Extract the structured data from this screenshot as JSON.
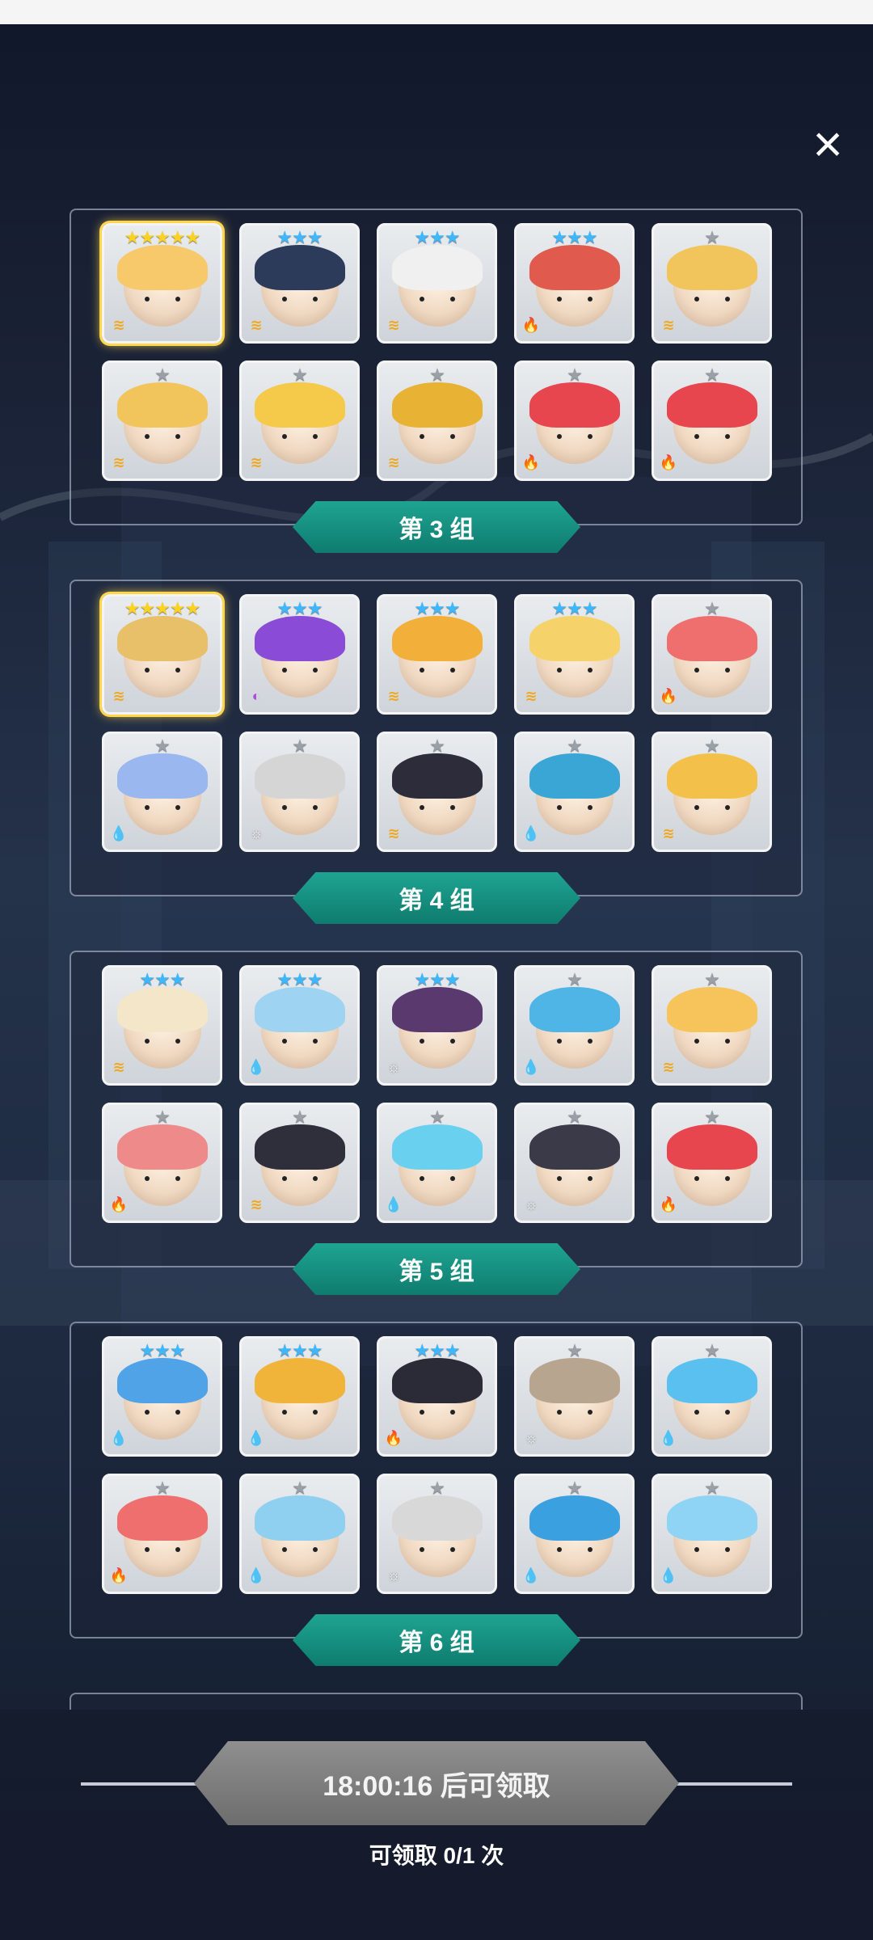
{
  "close_icon": "close-icon",
  "groups": [
    {
      "label": "第 3 组",
      "cards": [
        {
          "stars": "★★★★★",
          "rank": "s5",
          "element": "wind",
          "gold": true,
          "hair": "#f7c96a"
        },
        {
          "stars": "★★★",
          "rank": "s3",
          "element": "wind",
          "gold": false,
          "hair": "#2d3b5a"
        },
        {
          "stars": "★★★",
          "rank": "s3",
          "element": "wind",
          "gold": false,
          "hair": "#f0f0f0"
        },
        {
          "stars": "★★★",
          "rank": "s3",
          "element": "fire",
          "gold": false,
          "hair": "#e05a4e"
        },
        {
          "stars": "★",
          "rank": "s1",
          "element": "wind",
          "gold": false,
          "hair": "#f2c55c"
        },
        {
          "stars": "★",
          "rank": "s1",
          "element": "wind",
          "gold": false,
          "hair": "#f2c55c"
        },
        {
          "stars": "★",
          "rank": "s1",
          "element": "wind",
          "gold": false,
          "hair": "#f5c94a"
        },
        {
          "stars": "★",
          "rank": "s1",
          "element": "wind",
          "gold": false,
          "hair": "#e8b234"
        },
        {
          "stars": "★",
          "rank": "s1",
          "element": "fire",
          "gold": false,
          "hair": "#e8464e"
        },
        {
          "stars": "★",
          "rank": "s1",
          "element": "fire",
          "gold": false,
          "hair": "#e8464e"
        }
      ]
    },
    {
      "label": "第 4 组",
      "cards": [
        {
          "stars": "★★★★★",
          "rank": "s5",
          "element": "wind",
          "gold": true,
          "hair": "#e8c06a"
        },
        {
          "stars": "★★★",
          "rank": "s3",
          "element": "dark",
          "gold": false,
          "hair": "#8a4bd6"
        },
        {
          "stars": "★★★",
          "rank": "s3",
          "element": "wind",
          "gold": false,
          "hair": "#f2b03a"
        },
        {
          "stars": "★★★",
          "rank": "s3",
          "element": "wind",
          "gold": false,
          "hair": "#f6d36a"
        },
        {
          "stars": "★",
          "rank": "s1",
          "element": "fire",
          "gold": false,
          "hair": "#ef6f6f"
        },
        {
          "stars": "★",
          "rank": "s1",
          "element": "water",
          "gold": false,
          "hair": "#9bb7ef"
        },
        {
          "stars": "★",
          "rank": "s1",
          "element": "light",
          "gold": false,
          "hair": "#d5d5d5"
        },
        {
          "stars": "★",
          "rank": "s1",
          "element": "wind",
          "gold": false,
          "hair": "#2c2c3a"
        },
        {
          "stars": "★",
          "rank": "s1",
          "element": "water",
          "gold": false,
          "hair": "#3aa6d6"
        },
        {
          "stars": "★",
          "rank": "s1",
          "element": "wind",
          "gold": false,
          "hair": "#f3c14a"
        }
      ]
    },
    {
      "label": "第 5 组",
      "cards": [
        {
          "stars": "★★★",
          "rank": "s3",
          "element": "wind",
          "gold": false,
          "hair": "#f4e6c8"
        },
        {
          "stars": "★★★",
          "rank": "s3",
          "element": "water",
          "gold": false,
          "hair": "#9fd3f2"
        },
        {
          "stars": "★★★",
          "rank": "s3",
          "element": "light",
          "gold": false,
          "hair": "#5a3a6e"
        },
        {
          "stars": "★",
          "rank": "s1",
          "element": "water",
          "gold": false,
          "hair": "#4fb5e6"
        },
        {
          "stars": "★",
          "rank": "s1",
          "element": "wind",
          "gold": false,
          "hair": "#f6c45a"
        },
        {
          "stars": "★",
          "rank": "s1",
          "element": "fire",
          "gold": false,
          "hair": "#ef8a8a"
        },
        {
          "stars": "★",
          "rank": "s1",
          "element": "wind",
          "gold": false,
          "hair": "#2f2f3c"
        },
        {
          "stars": "★",
          "rank": "s1",
          "element": "water",
          "gold": false,
          "hair": "#6ad0ef"
        },
        {
          "stars": "★",
          "rank": "s1",
          "element": "light",
          "gold": false,
          "hair": "#3a3a48"
        },
        {
          "stars": "★",
          "rank": "s1",
          "element": "fire",
          "gold": false,
          "hair": "#e8464e"
        }
      ]
    },
    {
      "label": "第 6 组",
      "cards": [
        {
          "stars": "★★★",
          "rank": "s3",
          "element": "water",
          "gold": false,
          "hair": "#4fa3e6"
        },
        {
          "stars": "★★★",
          "rank": "s3",
          "element": "water",
          "gold": false,
          "hair": "#f0b43a"
        },
        {
          "stars": "★★★",
          "rank": "s3",
          "element": "fire",
          "gold": false,
          "hair": "#2b2b38"
        },
        {
          "stars": "★",
          "rank": "s1",
          "element": "light",
          "gold": false,
          "hair": "#b8a58f"
        },
        {
          "stars": "★",
          "rank": "s1",
          "element": "water",
          "gold": false,
          "hair": "#5ac0ef"
        },
        {
          "stars": "★",
          "rank": "s1",
          "element": "fire",
          "gold": false,
          "hair": "#ef6f6f"
        },
        {
          "stars": "★",
          "rank": "s1",
          "element": "water",
          "gold": false,
          "hair": "#8fd0f0"
        },
        {
          "stars": "★",
          "rank": "s1",
          "element": "light",
          "gold": false,
          "hair": "#d8d8d8"
        },
        {
          "stars": "★",
          "rank": "s1",
          "element": "water",
          "gold": false,
          "hair": "#3aa0e0"
        },
        {
          "stars": "★",
          "rank": "s1",
          "element": "water",
          "gold": false,
          "hair": "#8fd3f5"
        }
      ]
    }
  ],
  "element_glyphs": {
    "water": "💧",
    "fire": "🔥",
    "wind": "≋",
    "light": "☼",
    "dark": "◐"
  },
  "claim": {
    "button_label": "18:00:16 后可领取",
    "count_text": "可领取 0/1 次"
  }
}
